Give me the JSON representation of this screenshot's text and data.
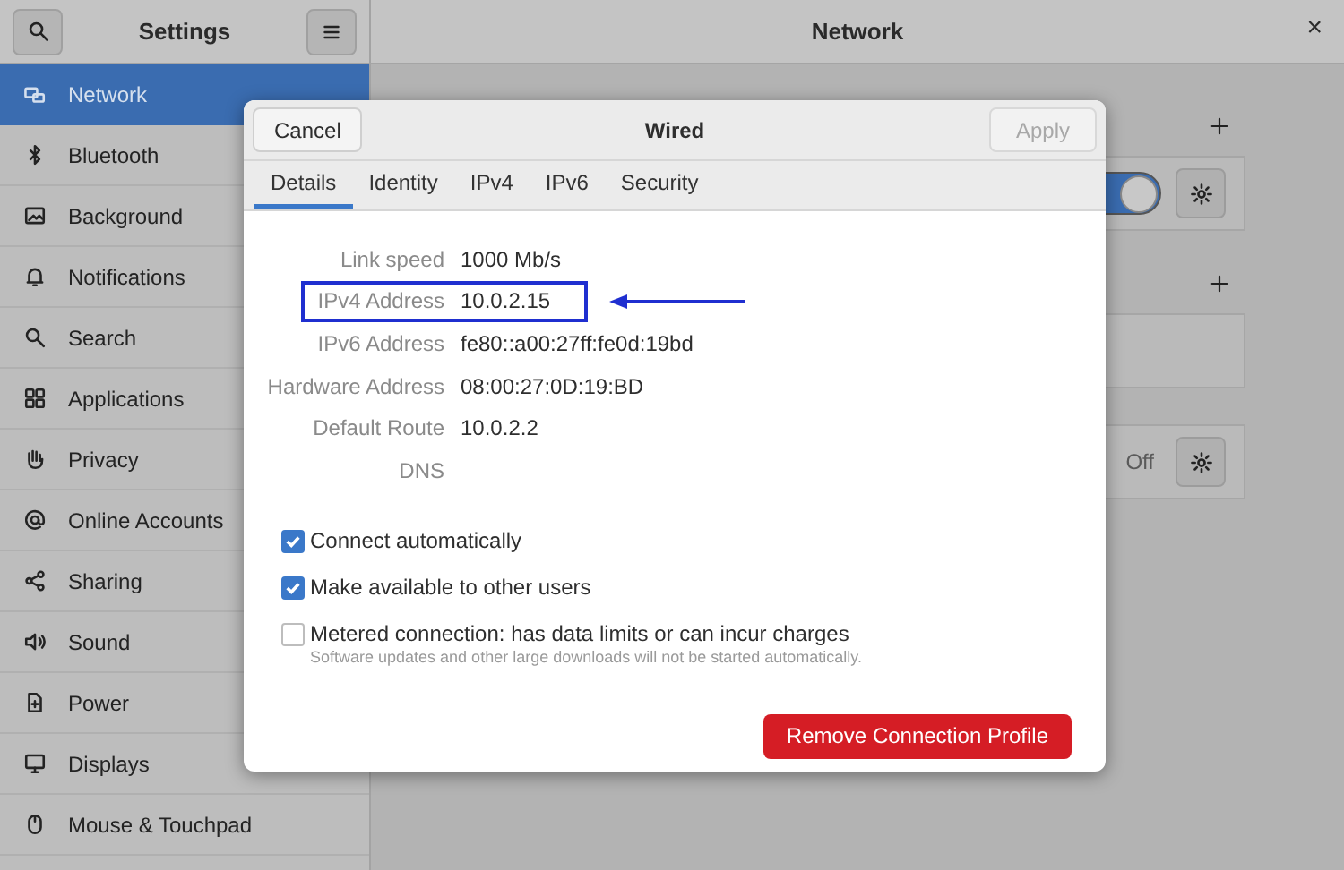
{
  "header": {
    "title": "Settings",
    "panel_title": "Network",
    "close": "×"
  },
  "sidebar": {
    "items": [
      {
        "label": "Network",
        "selected": true
      },
      {
        "label": "Bluetooth",
        "selected": false
      },
      {
        "label": "Background",
        "selected": false
      },
      {
        "label": "Notifications",
        "selected": false
      },
      {
        "label": "Search",
        "selected": false
      },
      {
        "label": "Applications",
        "selected": false
      },
      {
        "label": "Privacy",
        "selected": false
      },
      {
        "label": "Online Accounts",
        "selected": false
      },
      {
        "label": "Sharing",
        "selected": false
      },
      {
        "label": "Sound",
        "selected": false
      },
      {
        "label": "Power",
        "selected": false
      },
      {
        "label": "Displays",
        "selected": false
      },
      {
        "label": "Mouse & Touchpad",
        "selected": false
      }
    ]
  },
  "network_panel": {
    "sections": [
      {
        "add_button": true,
        "row": {
          "kind": "toggle",
          "on": true
        }
      },
      {
        "add_button": true,
        "row": {
          "kind": "empty"
        }
      },
      {
        "add_button": false,
        "row": {
          "kind": "status",
          "status": "Off"
        }
      }
    ]
  },
  "dialog": {
    "cancel": "Cancel",
    "title": "Wired",
    "apply": {
      "label": "Apply",
      "disabled": true
    },
    "tabs": [
      {
        "label": "Details",
        "selected": true
      },
      {
        "label": "Identity",
        "selected": false
      },
      {
        "label": "IPv4",
        "selected": false
      },
      {
        "label": "IPv6",
        "selected": false
      },
      {
        "label": "Security",
        "selected": false
      }
    ],
    "details": [
      {
        "label": "Link speed",
        "value": "1000 Mb/s",
        "highlighted": false
      },
      {
        "label": "IPv4 Address",
        "value": "10.0.2.15",
        "highlighted": true
      },
      {
        "label": "IPv6 Address",
        "value": "fe80::a00:27ff:fe0d:19bd",
        "highlighted": false
      },
      {
        "label": "Hardware Address",
        "value": "08:00:27:0D:19:BD",
        "highlighted": false
      },
      {
        "label": "Default Route",
        "value": "10.0.2.2",
        "highlighted": false
      },
      {
        "label": "DNS",
        "highlighted": false
      }
    ],
    "options": [
      {
        "label": "Connect automatically",
        "checked": true
      },
      {
        "label": "Make available to other users",
        "checked": true
      },
      {
        "label": "Metered connection: has data limits or can incur charges",
        "hint": "Software updates and other large downloads will not be started automatically.",
        "checked": false
      }
    ],
    "remove_button": "Remove Connection Profile"
  }
}
